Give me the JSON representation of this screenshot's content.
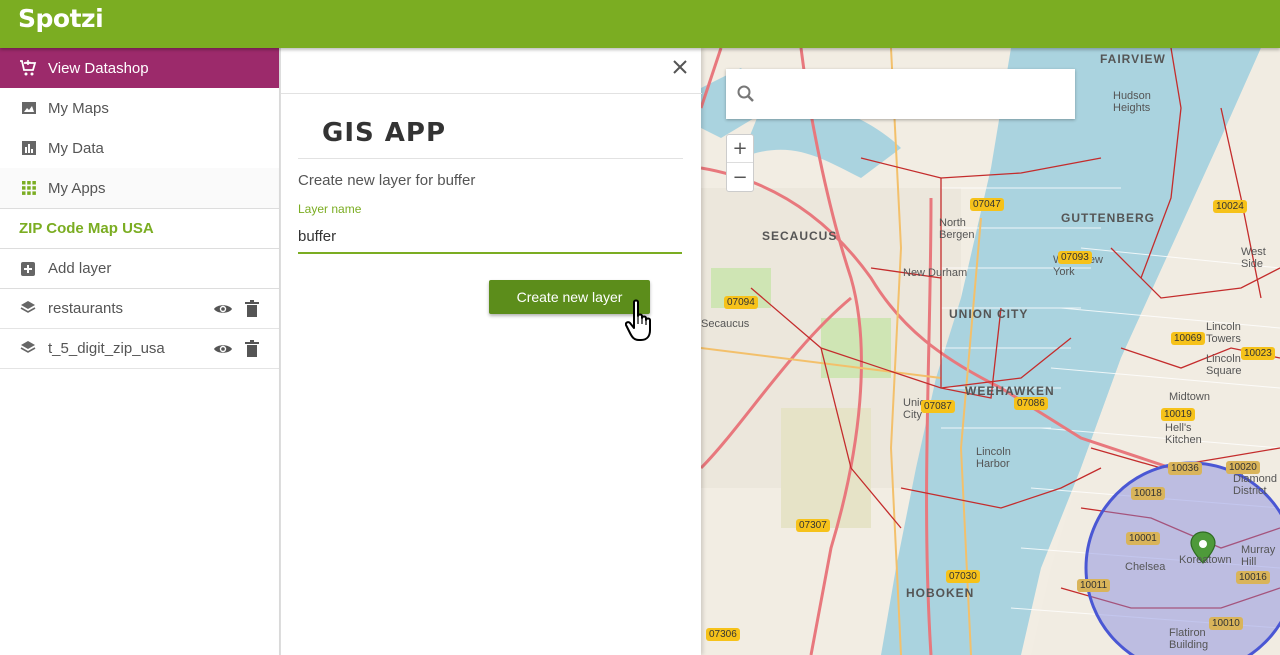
{
  "app": {
    "logo": "Spotzi"
  },
  "sidebar": {
    "datashop_label": "View Datashop",
    "nav": [
      {
        "label": "My Maps",
        "icon": "image-icon"
      },
      {
        "label": "My Data",
        "icon": "chart-icon"
      },
      {
        "label": "My Apps",
        "icon": "grid-icon"
      }
    ],
    "map_title": "ZIP Code Map USA",
    "add_layer_label": "Add layer",
    "layers": [
      {
        "name": "restaurants"
      },
      {
        "name": "t_5_digit_zip_usa"
      }
    ]
  },
  "panel": {
    "title": "GIS APP",
    "subtitle": "Create new layer for buffer",
    "field_label": "Layer name",
    "field_value": "buffer",
    "button_label": "Create new layer"
  },
  "map": {
    "search_placeholder": "",
    "zoom_in": "+",
    "zoom_out": "−",
    "places": [
      "FAIRVIEW",
      "Hudson Heights",
      "SECAUCUS",
      "North Bergen",
      "GUTTENBERG",
      "West New York",
      "New Durham",
      "UNION CITY",
      "WEEHAWKEN",
      "Union City",
      "Lincoln Harbor",
      "HOBOKEN",
      "Lincoln Towers",
      "Lincoln Square",
      "Midtown",
      "Hell's Kitchen",
      "Chelsea",
      "Koreatown",
      "Murray Hill",
      "Flatiron Building",
      "Diamond District",
      "West Side",
      "Secaucus"
    ],
    "zips": [
      "07047",
      "10024",
      "07093",
      "07094",
      "10069",
      "10023",
      "07087",
      "07086",
      "10019",
      "10036",
      "10020",
      "10018",
      "10001",
      "07307",
      "07030",
      "10011",
      "10016",
      "10010",
      "07306"
    ]
  }
}
